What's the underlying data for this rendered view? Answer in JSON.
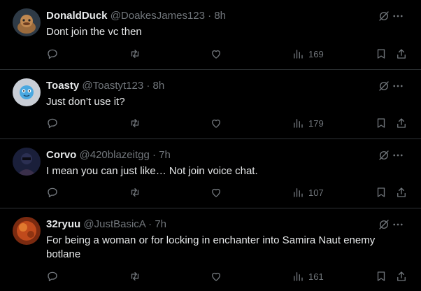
{
  "posts": [
    {
      "name": "DonaldDuck",
      "handle": "@DoakesJames123",
      "dot": "·",
      "time": "8h",
      "text": "Dont join the vc then",
      "views": "169"
    },
    {
      "name": "Toasty",
      "handle": "@Toastyt123",
      "dot": "·",
      "time": "8h",
      "text": "Just don’t use it?",
      "views": "179"
    },
    {
      "name": "Corvo",
      "handle": "@420blazeitgg",
      "dot": "·",
      "time": "7h",
      "text": "I mean you can just like… Not join voice chat.",
      "views": "107"
    },
    {
      "name": "32ryuu",
      "handle": "@JustBasicA",
      "dot": "·",
      "time": "7h",
      "text": "For being a woman or for locking in enchanter into Samira Naut enemy botlane",
      "views": "161"
    }
  ],
  "icons": {
    "reply": "reply-icon",
    "repost": "repost-icon",
    "like": "like-icon",
    "views": "views-icon",
    "bookmark": "bookmark-icon",
    "share": "share-icon",
    "grok": "grok-icon",
    "more": "more-icon"
  },
  "colors": {
    "background": "#000000",
    "text": "#e7e9ea",
    "muted": "#71767b",
    "divider": "#2f3336"
  }
}
